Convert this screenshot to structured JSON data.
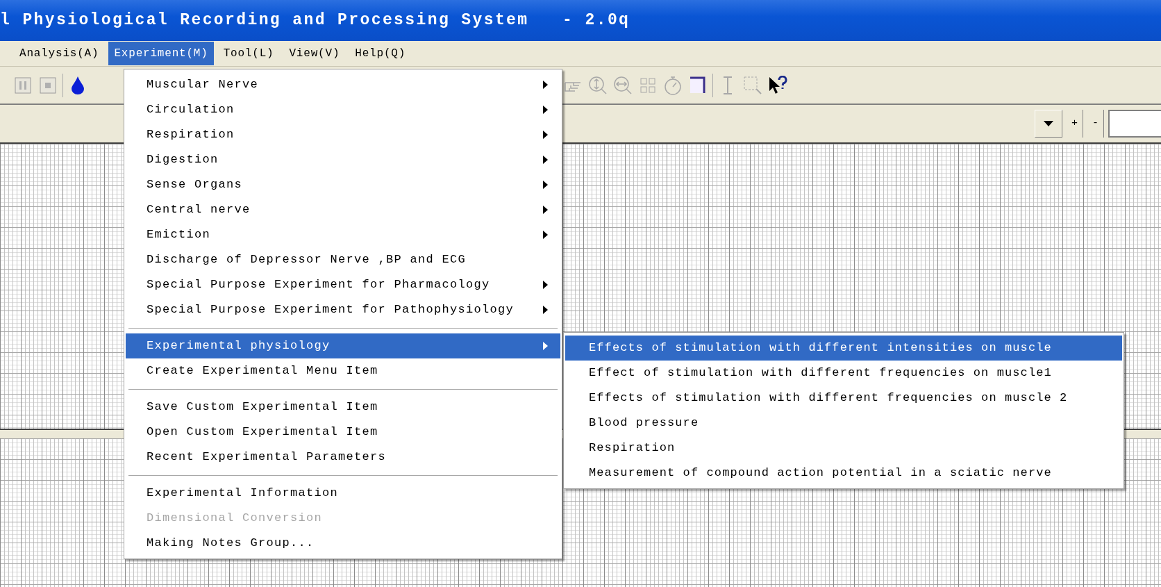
{
  "window": {
    "title": "l Physiological Recording and Processing System   - 2.0q"
  },
  "menubar": [
    {
      "label": "Analysis(A)",
      "selected": false
    },
    {
      "label": "Experiment(M)",
      "selected": true
    },
    {
      "label": "Tool(L)",
      "selected": false
    },
    {
      "label": "View(V)",
      "selected": false
    },
    {
      "label": "Help(Q)",
      "selected": false
    }
  ],
  "scale_controls": {
    "plus": "+",
    "minus": "-"
  },
  "menu": {
    "items": [
      {
        "kind": "item",
        "label": "Muscular Nerve",
        "submenu": true,
        "selected": false,
        "disabled": false
      },
      {
        "kind": "item",
        "label": "Circulation",
        "submenu": true,
        "selected": false,
        "disabled": false
      },
      {
        "kind": "item",
        "label": "Respiration",
        "submenu": true,
        "selected": false,
        "disabled": false
      },
      {
        "kind": "item",
        "label": "Digestion",
        "submenu": true,
        "selected": false,
        "disabled": false
      },
      {
        "kind": "item",
        "label": "Sense Organs",
        "submenu": true,
        "selected": false,
        "disabled": false
      },
      {
        "kind": "item",
        "label": "Central nerve",
        "submenu": true,
        "selected": false,
        "disabled": false
      },
      {
        "kind": "item",
        "label": "Emiction",
        "submenu": true,
        "selected": false,
        "disabled": false
      },
      {
        "kind": "item",
        "label": "Discharge of Depressor Nerve ,BP and ECG",
        "submenu": false,
        "selected": false,
        "disabled": false
      },
      {
        "kind": "item",
        "label": "Special Purpose Experiment for Pharmacology",
        "submenu": true,
        "selected": false,
        "disabled": false
      },
      {
        "kind": "item",
        "label": "Special Purpose Experiment for Pathophysiology",
        "submenu": true,
        "selected": false,
        "disabled": false
      },
      {
        "kind": "separator"
      },
      {
        "kind": "item",
        "label": "Experimental physiology",
        "submenu": true,
        "selected": true,
        "disabled": false
      },
      {
        "kind": "item",
        "label": "Create Experimental Menu Item",
        "submenu": false,
        "selected": false,
        "disabled": false
      },
      {
        "kind": "separator"
      },
      {
        "kind": "item",
        "label": "Save Custom Experimental Item",
        "submenu": false,
        "selected": false,
        "disabled": false
      },
      {
        "kind": "item",
        "label": "Open Custom Experimental Item",
        "submenu": false,
        "selected": false,
        "disabled": false
      },
      {
        "kind": "item",
        "label": "Recent Experimental Parameters",
        "submenu": false,
        "selected": false,
        "disabled": false
      },
      {
        "kind": "separator"
      },
      {
        "kind": "item",
        "label": "Experimental Information",
        "submenu": false,
        "selected": false,
        "disabled": false
      },
      {
        "kind": "item",
        "label": "Dimensional Conversion",
        "submenu": false,
        "selected": false,
        "disabled": true
      },
      {
        "kind": "item",
        "label": "Making Notes Group...",
        "submenu": false,
        "selected": false,
        "disabled": false
      }
    ]
  },
  "submenu": {
    "items": [
      {
        "label": "Effects of stimulation with different intensities on muscle",
        "selected": true
      },
      {
        "label": "Effect of stimulation with different frequencies on muscle1",
        "selected": false
      },
      {
        "label": "Effects of stimulation with different frequencies on muscle 2",
        "selected": false
      },
      {
        "label": "Blood pressure",
        "selected": false
      },
      {
        "label": "Respiration",
        "selected": false
      },
      {
        "label": "Measurement of compound action potential in a sciatic nerve",
        "selected": false
      }
    ]
  }
}
